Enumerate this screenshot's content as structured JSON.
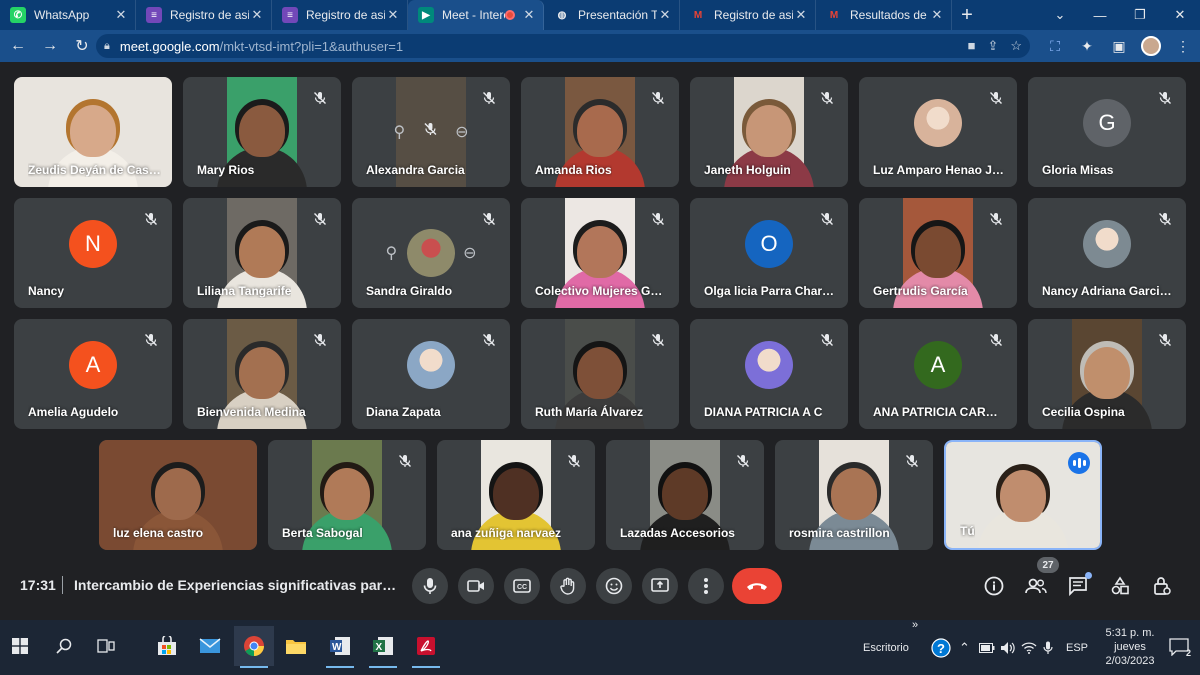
{
  "browser": {
    "tabs": [
      {
        "title": "WhatsApp",
        "icon": "whatsapp-icon",
        "color": "#25d366"
      },
      {
        "title": "Registro de asiste",
        "icon": "forms-icon",
        "color": "#7248b9"
      },
      {
        "title": "Registro de asiste",
        "icon": "forms-icon",
        "color": "#7248b9"
      },
      {
        "title": "Meet - Interc",
        "icon": "meet-icon",
        "color": "#00897b"
      },
      {
        "title": "Presentación Trab",
        "icon": "globe-icon",
        "color": "#e8eaed"
      },
      {
        "title": "Registro de asiste",
        "icon": "gmail-icon",
        "color": "#ea4335"
      },
      {
        "title": "Resultados de la",
        "icon": "gmail-icon",
        "color": "#ea4335"
      }
    ],
    "url_host": "meet.google.com",
    "url_path": "/mkt-vtsd-imt?pli=1&authuser=1"
  },
  "participants": [
    {
      "name": "Zeudis Deyán de Cas…",
      "type": "video",
      "skin": "#d7a98a",
      "bg": "#e8e4de",
      "shirt": "#f3efe8",
      "hair": "#b3752f"
    },
    {
      "name": "Mary Rios",
      "type": "video",
      "skin": "#8a5a3f",
      "bg": "#3aa06a",
      "shirt": "#2a2a2a",
      "hair": "#1b1b1b"
    },
    {
      "name": "Alexandra Garcia",
      "type": "pinned",
      "bg": "#6b5a45"
    },
    {
      "name": "Amanda Rios",
      "type": "video",
      "skin": "#a86a4d",
      "bg": "#7a5840",
      "shirt": "#b3392f",
      "hair": "#2b2b2b"
    },
    {
      "name": "Janeth Holguin",
      "type": "video",
      "skin": "#c79677",
      "bg": "#dcd6cd",
      "shirt": "#8c3a46",
      "hair": "#7a5a3a"
    },
    {
      "name": "Luz Amparo Henao J…",
      "type": "avatar",
      "color": "#d8b39b"
    },
    {
      "name": "Gloria Misas",
      "type": "initial",
      "initial": "G",
      "color": "#5f6368"
    },
    {
      "name": "Nancy",
      "type": "initial",
      "initial": "N",
      "color": "#f4511e"
    },
    {
      "name": "Liliana Tangarife",
      "type": "video",
      "skin": "#b07a57",
      "bg": "#6e6a64",
      "shirt": "#e9e5de",
      "hair": "#1a1a1a"
    },
    {
      "name": "Sandra Giraldo",
      "type": "pinned-avatar",
      "color": "#8e8a6a"
    },
    {
      "name": "Colectivo Mujeres G…",
      "type": "video",
      "skin": "#b2765a",
      "bg": "#ece7e3",
      "shirt": "#e06aa6",
      "hair": "#1c1c1c"
    },
    {
      "name": "Olga licia Parra Char…",
      "type": "initial",
      "initial": "O",
      "color": "#1565c0"
    },
    {
      "name": "Gertrudis García",
      "type": "video",
      "skin": "#7a4a31",
      "bg": "#a5583b",
      "shirt": "#e38aa8",
      "hair": "#161616"
    },
    {
      "name": "Nancy Adriana Garci…",
      "type": "avatar",
      "color": "#7d8a92"
    },
    {
      "name": "Amelia Agudelo",
      "type": "initial",
      "initial": "A",
      "color": "#f4511e"
    },
    {
      "name": "Bienvenida Medina",
      "type": "video",
      "skin": "#a37050",
      "bg": "#6b5b45",
      "shirt": "#d8d0c3",
      "hair": "#2a2a2a"
    },
    {
      "name": "Diana Zapata",
      "type": "avatar",
      "color": "#8ba7c5"
    },
    {
      "name": "Ruth María Álvarez",
      "type": "video",
      "skin": "#7e5038",
      "bg": "#4a4d4a",
      "shirt": "#3c3c3c",
      "hair": "#151515"
    },
    {
      "name": "DIANA PATRICIA A C",
      "type": "avatar",
      "color": "#7c6fd8"
    },
    {
      "name": "ANA PATRICIA CAR…",
      "type": "initial",
      "initial": "A",
      "color": "#33691e"
    },
    {
      "name": "Cecilia Ospina",
      "type": "video",
      "skin": "#c08f6c",
      "bg": "#5a4632",
      "shirt": "#2b2b2b",
      "hair": "#bfbcb6"
    },
    {
      "name": "luz elena castro",
      "type": "video",
      "skin": "#9e6a4c",
      "bg": "#7a4a32",
      "shirt": "#8a5638",
      "hair": "#1c1c1c"
    },
    {
      "name": "Berta Sabogal",
      "type": "video",
      "skin": "#b07a58",
      "bg": "#6b7a4e",
      "shirt": "#3aa06a",
      "hair": "#221a14"
    },
    {
      "name": "ana zuñiga narvaez",
      "type": "video",
      "skin": "#4f3023",
      "bg": "#e9e6df",
      "shirt": "#e3c433",
      "hair": "#141414"
    },
    {
      "name": "Lazadas Accesorios",
      "type": "video",
      "skin": "#5e3a27",
      "bg": "#8a8c86",
      "shirt": "#1f1f1f",
      "hair": "#111111"
    },
    {
      "name": "rosmira castrillon",
      "type": "video",
      "skin": "#a97454",
      "bg": "#e6e1da",
      "shirt": "#7b8a95",
      "hair": "#2a2a2a"
    },
    {
      "name": "Tú",
      "type": "self",
      "skin": "#c08d6e",
      "bg": "#e7e5e0",
      "shirt": "#e9e6de",
      "hair": "#2a2018"
    }
  ],
  "meeting": {
    "time": "17:31",
    "title": "Intercambio de Experiencias significativas par…",
    "participant_count": "27"
  },
  "taskbar": {
    "apps": [
      "windows-start-icon",
      "search-icon",
      "task-view-icon",
      "store-icon",
      "mail-icon",
      "chrome-icon",
      "file-explorer-icon",
      "word-icon",
      "excel-icon",
      "acrobat-icon"
    ],
    "desktop_label": "Escritorio",
    "language": "ESP",
    "clock_time": "5:31 p. m.",
    "clock_day": "jueves",
    "clock_date": "2/03/2023",
    "notifications": "2"
  }
}
